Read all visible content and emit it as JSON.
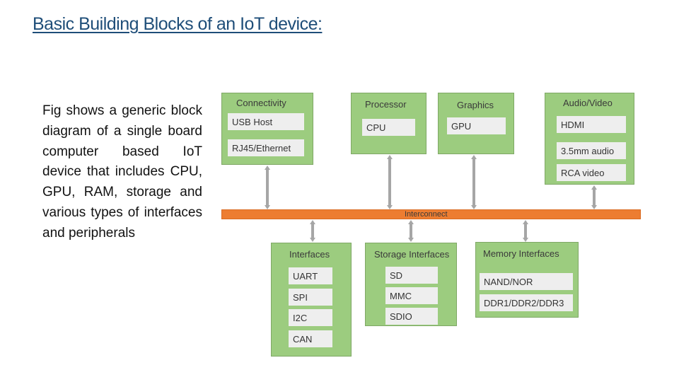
{
  "title": "Basic Building Blocks of an IoT device:",
  "description": "Fig shows a generic block diagram of a single board computer based IoT device that includes CPU, GPU, RAM, storage and various types of interfaces and peripherals",
  "colors": {
    "block_fill": "#9ccc7f",
    "item_fill": "#eeeeee",
    "interconnect": "#ed7d31",
    "arrow": "#a6a6a6",
    "title": "#1f4e79"
  },
  "diagram": {
    "interconnect_label": "Interconnect",
    "top_blocks": [
      {
        "title": "Connectivity",
        "items": [
          "USB Host",
          "RJ45/Ethernet"
        ]
      },
      {
        "title": "Processor",
        "items": [
          "CPU"
        ]
      },
      {
        "title": "Graphics",
        "items": [
          "GPU"
        ]
      },
      {
        "title": "Audio/Video",
        "items": [
          "HDMI",
          "3.5mm audio",
          "RCA video"
        ]
      }
    ],
    "bottom_blocks": [
      {
        "title": "Interfaces",
        "items": [
          "UART",
          "SPI",
          "I2C",
          "CAN"
        ]
      },
      {
        "title": "Storage Interfaces",
        "items": [
          "SD",
          "MMC",
          "SDIO"
        ]
      },
      {
        "title": "Memory Interfaces",
        "items": [
          "NAND/NOR",
          "DDR1/DDR2/DDR3"
        ]
      }
    ]
  }
}
